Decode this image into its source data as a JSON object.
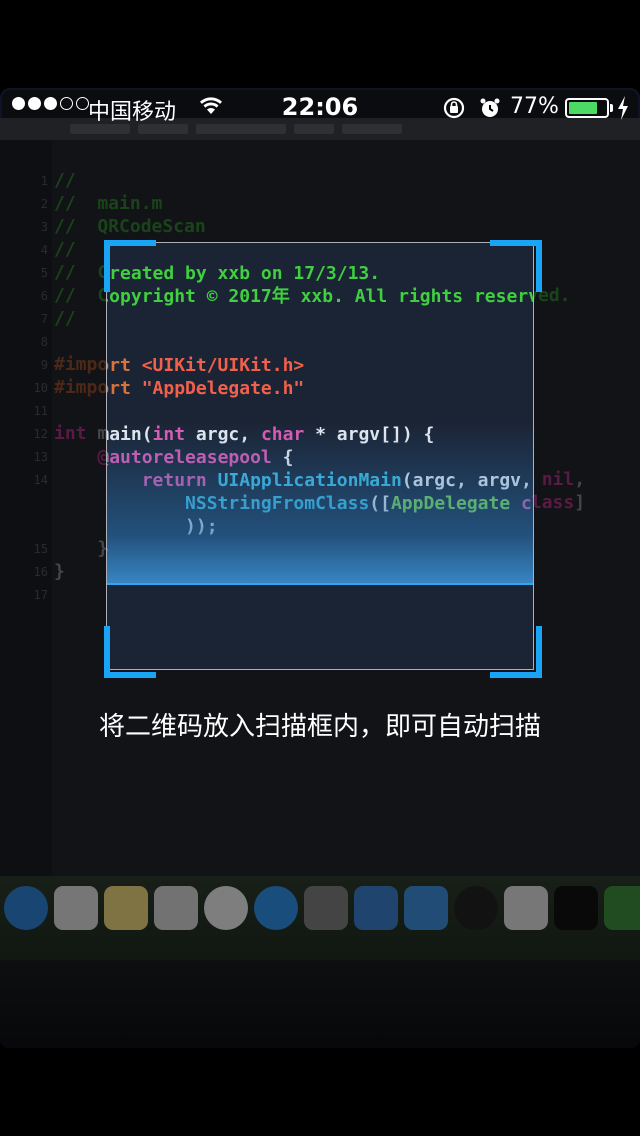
{
  "status_bar": {
    "carrier": "中国移动",
    "time": "22:06",
    "battery_percent": "77%",
    "battery_level": 0.77,
    "signal_bars_filled": 3,
    "signal_bars_total": 5,
    "icons": [
      "wifi-icon",
      "rotation-lock-icon",
      "alarm-icon",
      "charging-icon"
    ]
  },
  "scanner": {
    "hint": "将二维码放入扫描框内，即可自动扫描",
    "frame_color": "#1aa4f5",
    "scan_line_color": "#2fa6ee"
  },
  "camera_code": {
    "lines": [
      {
        "n": "1",
        "segs": [
          {
            "c": "c-comment",
            "t": "//"
          }
        ]
      },
      {
        "n": "2",
        "segs": [
          {
            "c": "c-comment",
            "t": "//  main.m"
          }
        ]
      },
      {
        "n": "3",
        "segs": [
          {
            "c": "c-comment",
            "t": "//  QRCodeScan"
          }
        ]
      },
      {
        "n": "4",
        "segs": [
          {
            "c": "c-comment",
            "t": "//"
          }
        ]
      },
      {
        "n": "5",
        "segs": [
          {
            "c": "c-comment",
            "t": "//  Created by xxb on 17/3/13."
          }
        ]
      },
      {
        "n": "6",
        "segs": [
          {
            "c": "c-comment",
            "t": "//  Copyright © 2017年 xxb. All rights reserved."
          }
        ]
      },
      {
        "n": "7",
        "segs": [
          {
            "c": "c-comment",
            "t": "//"
          }
        ]
      },
      {
        "n": "8",
        "segs": []
      },
      {
        "n": "9",
        "segs": [
          {
            "c": "c-pre",
            "t": "#import "
          },
          {
            "c": "c-str",
            "t": "<UIKit/UIKit.h>"
          }
        ]
      },
      {
        "n": "10",
        "segs": [
          {
            "c": "c-pre",
            "t": "#import "
          },
          {
            "c": "c-str",
            "t": "\"AppDelegate.h\""
          }
        ]
      },
      {
        "n": "11",
        "segs": []
      },
      {
        "n": "12",
        "segs": [
          {
            "c": "c-kw",
            "t": "int "
          },
          {
            "c": "c-plain",
            "t": "main("
          },
          {
            "c": "c-kw",
            "t": "int "
          },
          {
            "c": "c-plain",
            "t": "argc, "
          },
          {
            "c": "c-kw",
            "t": "char "
          },
          {
            "c": "c-plain",
            "t": "* argv[]) {"
          }
        ]
      },
      {
        "n": "13",
        "segs": [
          {
            "c": "c-plain",
            "t": "    "
          },
          {
            "c": "c-kw",
            "t": "@autoreleasepool "
          },
          {
            "c": "c-plain",
            "t": "{"
          }
        ]
      },
      {
        "n": "14",
        "segs": [
          {
            "c": "c-plain",
            "t": "        "
          },
          {
            "c": "c-kw",
            "t": "return "
          },
          {
            "c": "c-func",
            "t": "UIApplicationMain"
          },
          {
            "c": "c-plain",
            "t": "(argc, argv, "
          },
          {
            "c": "c-kw",
            "t": "nil"
          },
          {
            "c": "c-plain",
            "t": ","
          }
        ]
      },
      {
        "n": "",
        "segs": [
          {
            "c": "c-plain",
            "t": "            "
          },
          {
            "c": "c-func",
            "t": "NSStringFromClass"
          },
          {
            "c": "c-plain",
            "t": "(["
          },
          {
            "c": "c-cls",
            "t": "AppDelegate "
          },
          {
            "c": "c-kw",
            "t": "class"
          },
          {
            "c": "c-plain",
            "t": "]"
          }
        ]
      },
      {
        "n": "",
        "segs": [
          {
            "c": "c-plain",
            "t": "            ));"
          }
        ]
      },
      {
        "n": "15",
        "segs": [
          {
            "c": "c-plain",
            "t": "    }"
          }
        ]
      },
      {
        "n": "16",
        "segs": [
          {
            "c": "c-plain",
            "t": "}"
          }
        ]
      },
      {
        "n": "17",
        "segs": []
      }
    ]
  }
}
